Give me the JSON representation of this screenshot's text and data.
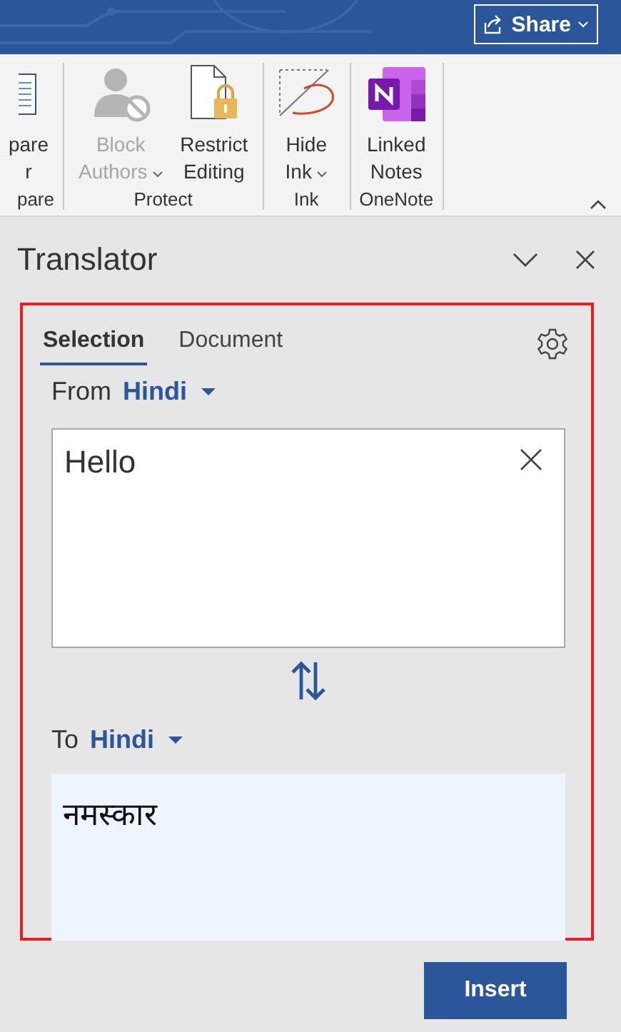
{
  "title_bar": {
    "share_button": "Share"
  },
  "ribbon": {
    "groups": [
      {
        "label": "pare",
        "buttons": [
          {
            "kind": "compare",
            "lines": [
              "pare",
              "r"
            ],
            "disabled": false,
            "dropdown": false
          }
        ]
      },
      {
        "label": "Protect",
        "buttons": [
          {
            "kind": "block",
            "lines": [
              "Block",
              "Authors"
            ],
            "disabled": true,
            "dropdown": true
          },
          {
            "kind": "restrict",
            "lines": [
              "Restrict",
              "Editing"
            ],
            "disabled": false,
            "dropdown": false
          }
        ]
      },
      {
        "label": "Ink",
        "buttons": [
          {
            "kind": "ink",
            "lines": [
              "Hide",
              "Ink"
            ],
            "disabled": false,
            "dropdown": true
          }
        ]
      },
      {
        "label": "OneNote",
        "buttons": [
          {
            "kind": "onenote",
            "lines": [
              "Linked",
              "Notes"
            ],
            "disabled": false,
            "dropdown": false
          }
        ]
      }
    ]
  },
  "translator": {
    "title": "Translator",
    "tabs": [
      {
        "label": "Selection",
        "selected": true
      },
      {
        "label": "Document",
        "selected": false
      }
    ],
    "from": {
      "label": "From",
      "language": "Hindi"
    },
    "input": {
      "value": "Hello"
    },
    "to": {
      "label": "To",
      "language": "Hindi"
    },
    "output": {
      "value": "नमस्कार"
    },
    "insert_button": "Insert"
  }
}
